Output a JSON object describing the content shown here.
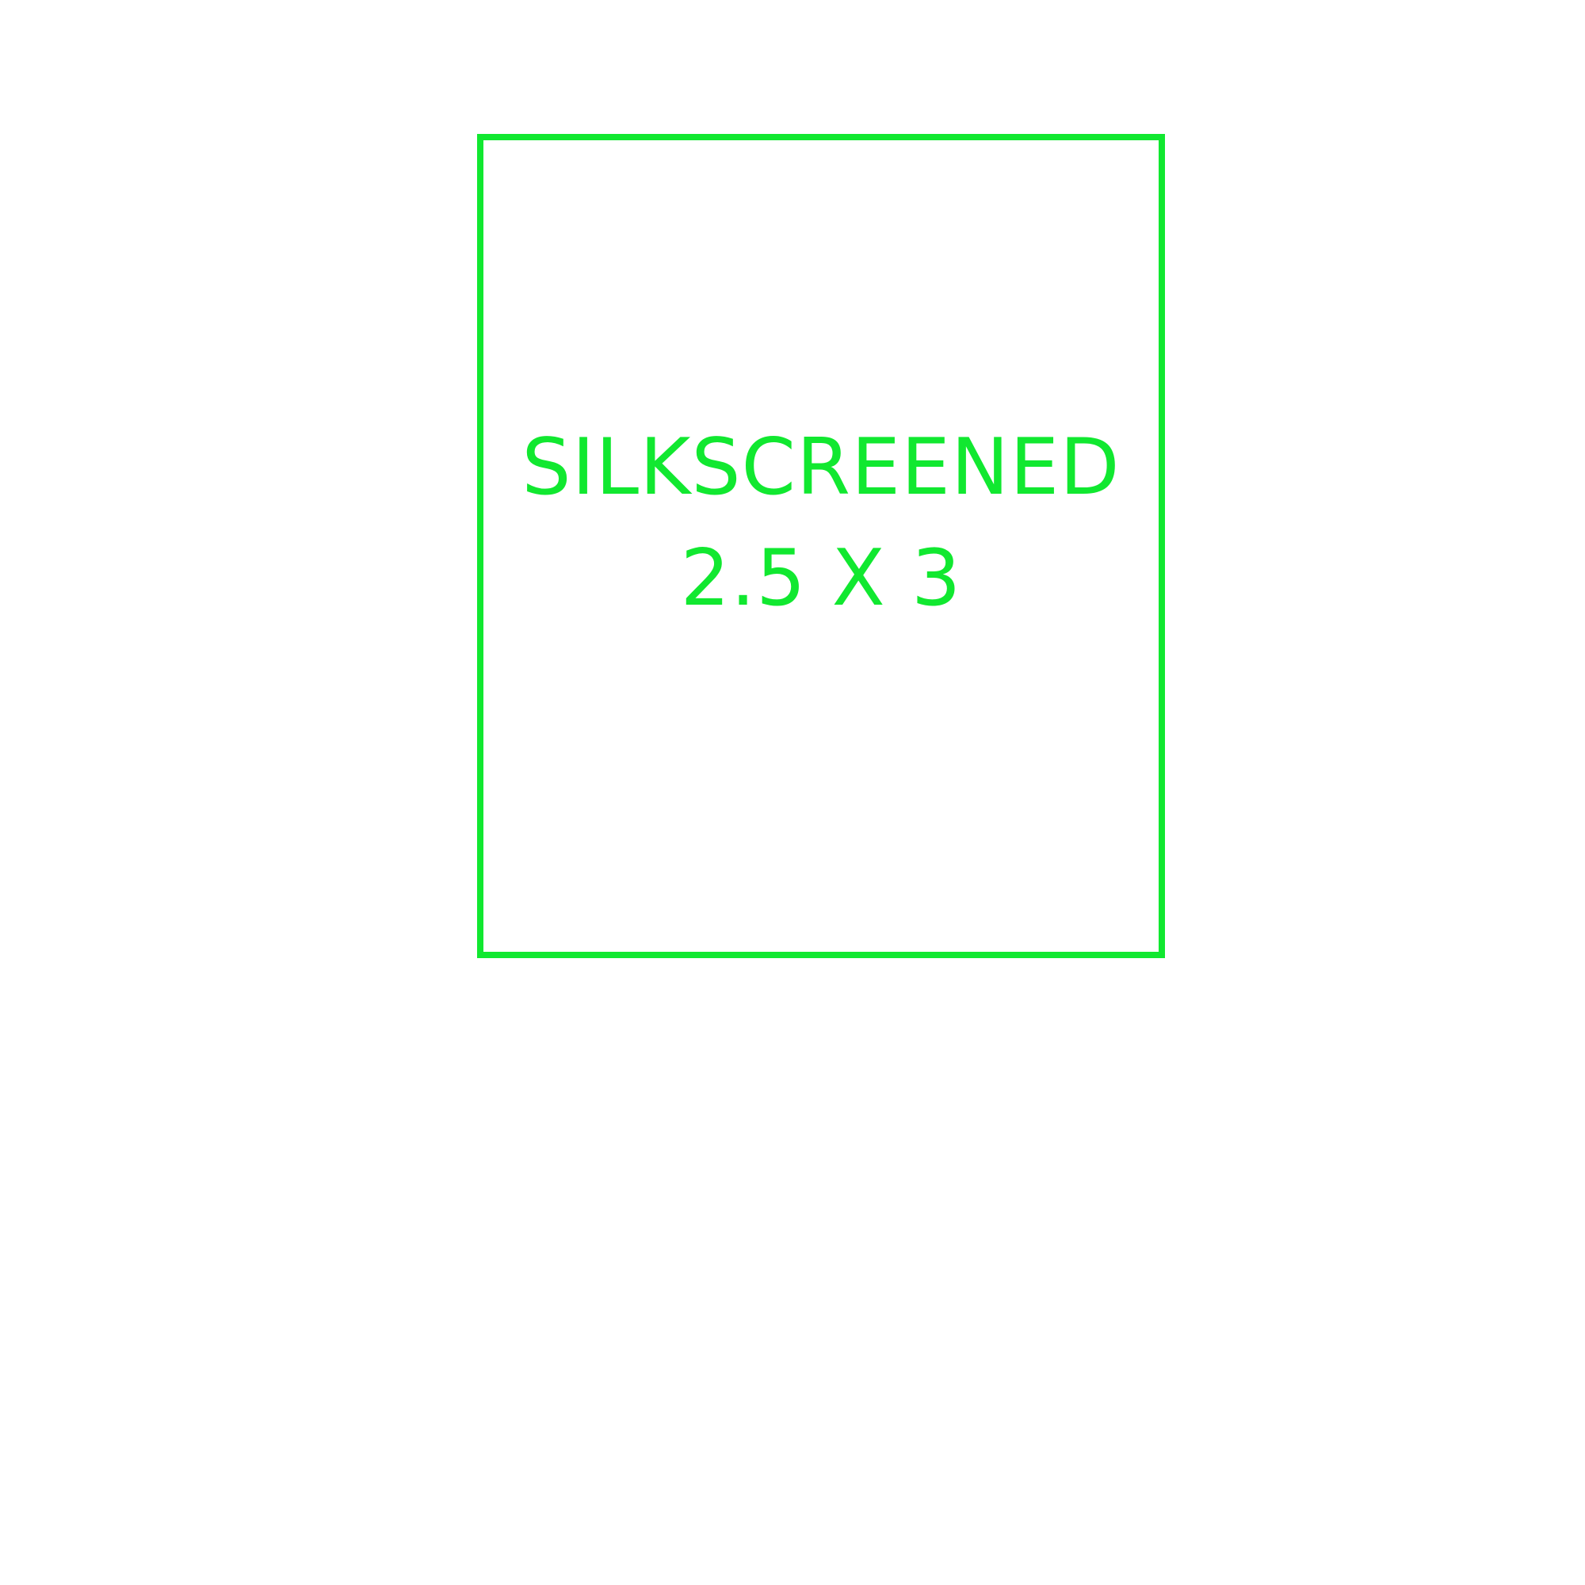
{
  "diagram": {
    "accent_color": "#11e830",
    "background_color": "#ffffff",
    "label": {
      "line1": "SILKSCREENED",
      "line2": "2.5 X 3"
    }
  }
}
